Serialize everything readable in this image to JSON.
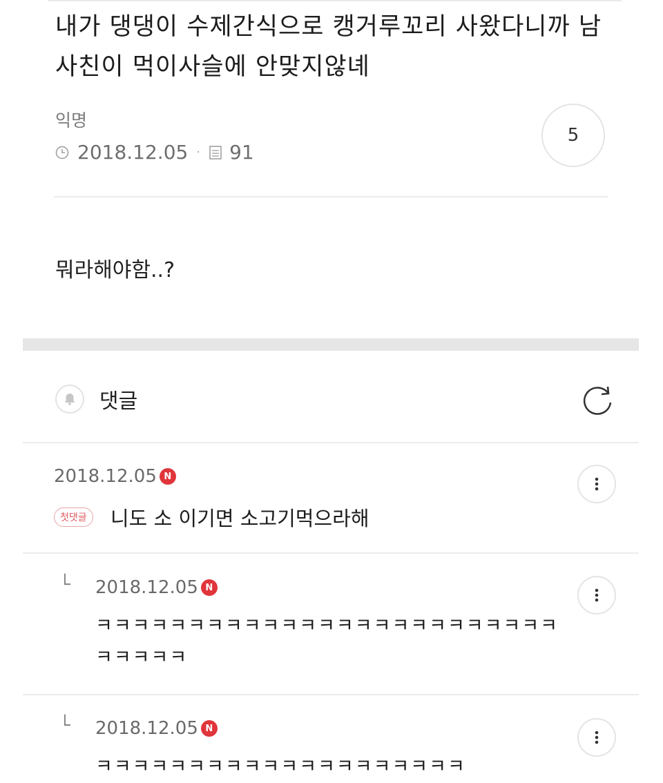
{
  "post": {
    "title": "내가 댕댕이 수제간식으로 캥거루꼬리 사왔다니까 남사친이 먹이사슬에 안맞지않녜",
    "author": "익명",
    "date": "2018.12.05",
    "views": "91",
    "comment_count": "5",
    "body": "뭐라해야함..?"
  },
  "comments_section": {
    "title": "댓글"
  },
  "comments": [
    {
      "date": "2018.12.05",
      "badge_new": "N",
      "first_label": "첫댓글",
      "text": "니도 소 이기면 소고기먹으라해"
    },
    {
      "reply_mark": "└",
      "date": "2018.12.05",
      "badge_new": "N",
      "text": "ㅋㅋㅋㅋㅋㅋㅋㅋㅋㅋㅋㅋㅋㅋㅋㅋㅋㅋㅋㅋㅋㅋㅋㅋㅋㅋㅋㅋㅋㅋ"
    },
    {
      "reply_mark": "└",
      "date": "2018.12.05",
      "badge_new": "N",
      "text": "ㅋㅋㅋㅋㅋㅋㅋㅋㅋㅋㅋㅋㅋㅋㅋㅋㅋㅋㅋㅋ"
    }
  ]
}
